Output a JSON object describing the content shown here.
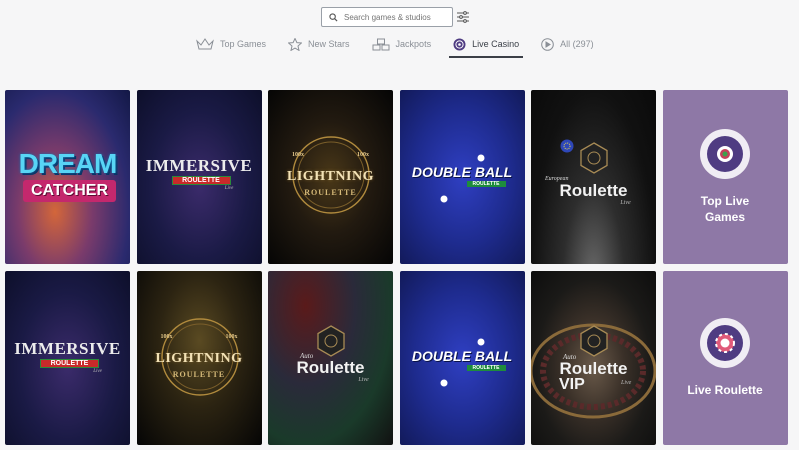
{
  "search": {
    "placeholder": "Search games & studios"
  },
  "tabs": [
    {
      "label": "Top Games",
      "icon": "crown-icon",
      "active": false
    },
    {
      "label": "New Stars",
      "icon": "star-icon",
      "active": false
    },
    {
      "label": "Jackpots",
      "icon": "jackpot-icon",
      "active": false
    },
    {
      "label": "Live Casino",
      "icon": "live-casino-icon",
      "active": true
    },
    {
      "label": "All (297)",
      "icon": "play-icon",
      "active": false
    }
  ],
  "games": {
    "row1": [
      {
        "logo_line1": "DREAM",
        "logo_line2": "CATCHER"
      },
      {
        "logo_line1": "IMMERSIVE",
        "logo_line2": "ROULETTE",
        "logo_line3": "Live"
      },
      {
        "logo_top": "100x",
        "logo_top2": "100x",
        "logo_line1": "LIGHTNING",
        "logo_line2": "ROULETTE"
      },
      {
        "logo_line1": "DOUBLE BALL",
        "logo_line2": "ROULETTE"
      },
      {
        "logo_line0": "European",
        "logo_line1": "Roulette",
        "logo_line2": "Live"
      },
      {
        "label_line1": "Top Live",
        "label_line2": "Games"
      }
    ],
    "row2": [
      {
        "logo_line1": "IMMERSIVE",
        "logo_line2": "ROULETTE",
        "logo_line3": "Live"
      },
      {
        "logo_top": "100x",
        "logo_top2": "100x",
        "logo_line1": "LIGHTNING",
        "logo_line2": "ROULETTE"
      },
      {
        "logo_line0": "Auto",
        "logo_line1": "Roulette",
        "logo_line2": "Live"
      },
      {
        "logo_line1": "DOUBLE BALL",
        "logo_line2": "ROULETTE"
      },
      {
        "logo_line0": "Auto",
        "logo_line1": "Roulette",
        "logo_line1b": "VIP",
        "logo_line2": "Live"
      },
      {
        "label_line1": "Live Roulette"
      }
    ]
  },
  "colors": {
    "accent_purple": "#8e78a6",
    "badge_purple": "#4f3c82",
    "background": "#f6f6f7"
  }
}
